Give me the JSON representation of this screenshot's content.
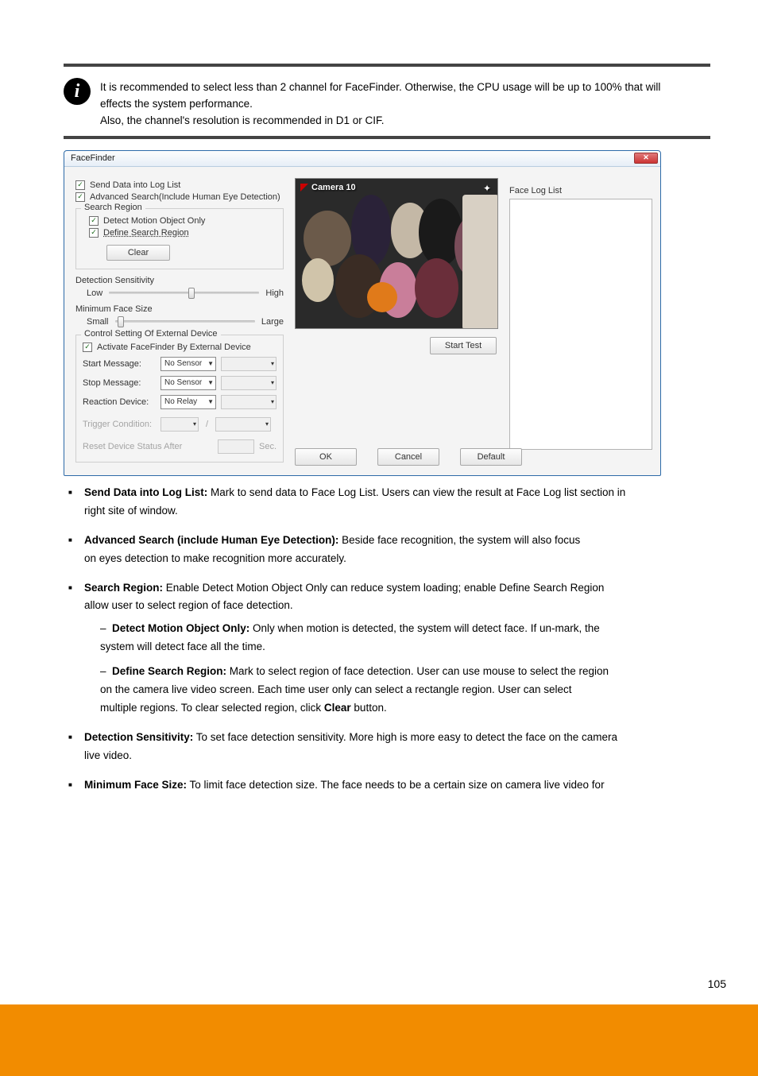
{
  "info": {
    "line1": "It is recommended to select less than 2 channel for FaceFinder. Otherwise, the CPU usage will be up to 100% that will",
    "line2": "effects the system performance.",
    "line3": "Also, the channel's resolution is recommended in D1 or CIF."
  },
  "dialog": {
    "title": "FaceFinder",
    "chk_send": "Send Data into Log List",
    "chk_adv": "Advanced Search(Include Human Eye Detection)",
    "search_region": {
      "legend": "Search Region",
      "chk_motion": "Detect Motion Object Only",
      "chk_define": "Define Search Region",
      "clear": "Clear"
    },
    "sens": {
      "label": "Detection Sensitivity",
      "low": "Low",
      "high": "High"
    },
    "minface": {
      "label": "Minimum Face Size",
      "small": "Small",
      "large": "Large"
    },
    "ext": {
      "legend": "Control Setting Of External Device",
      "chk_activate": "Activate FaceFinder By External Device",
      "start": "Start Message:",
      "stop": "Stop Message:",
      "reaction": "Reaction Device:",
      "no_sensor": "No Sensor",
      "no_relay": "No Relay",
      "trigger": "Trigger Condition:",
      "reset": "Reset Device Status After",
      "sec": "Sec."
    },
    "camera_label": "Camera 10",
    "start_test": "Start Test",
    "ok": "OK",
    "cancel": "Cancel",
    "default": "Default",
    "face_log": "Face Log List"
  },
  "body": {
    "b1_lead": "Send Data into Log List:",
    "b1_rest": " Mark to send data to Face Log List. Users can view the result at Face Log list section in ",
    "b1_line2": "right site of window.",
    "b2_lead": "Advanced Search (include Human Eye Detection):",
    "b2_rest": " Beside face recognition, the system will also focus ",
    "b2_line2": "on eyes detection to make recognition more accurately.",
    "b3_lead": "Search Region:",
    "b3_rest": " Enable Detect Motion Object Only can reduce system loading; enable Define Search Region ",
    "b3_line2": "allow user to select region of face detection.",
    "b3_s1_lead": "Detect Motion Object Only:",
    "b3_s1_rest": " Only when motion is detected, the system will detect face. If un-mark, the ",
    "b3_s1_line2": "system will detect face all the time.",
    "b3_s2_lead": "Define Search Region:",
    "b3_s2_rest": " Mark to select region of face detection. User can use mouse to select the region ",
    "b3_s2_line2": "on the camera live video screen. Each time user only can select a rectangle region. User can select ",
    "b3_s2_line3": "multiple regions. To clear selected region, click ",
    "b3_s2_clear": "Clear",
    "b3_s2_line3b": " button.",
    "b4_lead": "Detection Sensitivity:",
    "b4_rest": " To set face detection sensitivity. More high is more easy to detect the face on the camera ",
    "b4_line2": "live video.",
    "b5_lead": "Minimum Face Size:",
    "b5_rest": " To limit face detection size. The face needs to be a certain size on camera live video for "
  },
  "page_number": "105"
}
